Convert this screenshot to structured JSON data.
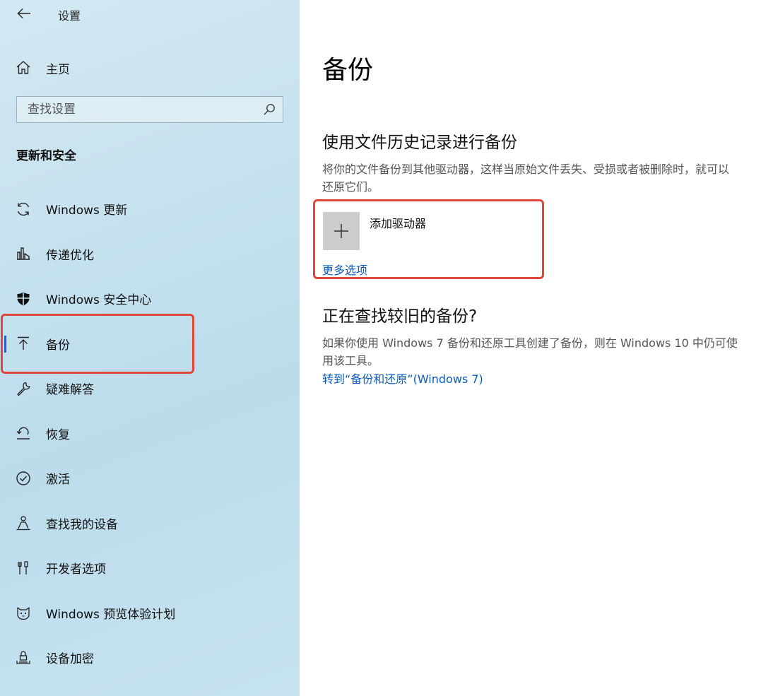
{
  "window": {
    "title": "设置",
    "back_icon": "arrow-left-icon"
  },
  "sidebar": {
    "home_label": "主页",
    "search_placeholder": "查找设置",
    "section_header": "更新和安全",
    "items": [
      {
        "label": "Windows 更新",
        "icon": "sync-icon",
        "selected": false
      },
      {
        "label": "传递优化",
        "icon": "delivery-optimization-icon",
        "selected": false
      },
      {
        "label": "Windows 安全中心",
        "icon": "shield-icon",
        "selected": false
      },
      {
        "label": "备份",
        "icon": "backup-arrow-up-icon",
        "selected": true
      },
      {
        "label": "疑难解答",
        "icon": "wrench-icon",
        "selected": false
      },
      {
        "label": "恢复",
        "icon": "recovery-icon",
        "selected": false
      },
      {
        "label": "激活",
        "icon": "check-circle-icon",
        "selected": false
      },
      {
        "label": "查找我的设备",
        "icon": "person-location-icon",
        "selected": false
      },
      {
        "label": "开发者选项",
        "icon": "developer-tools-icon",
        "selected": false
      },
      {
        "label": "Windows 预览体验计划",
        "icon": "insider-cat-icon",
        "selected": false
      },
      {
        "label": "设备加密",
        "icon": "device-encryption-icon",
        "selected": false
      }
    ]
  },
  "main": {
    "page_title": "备份",
    "file_history": {
      "heading": "使用文件历史记录进行备份",
      "description": "将你的文件备份到其他驱动器，这样当原始文件丢失、受损或者被删除时，就可以还原它们。",
      "add_drive_label": "添加驱动器",
      "more_options_link": "更多选项"
    },
    "older_backup": {
      "heading": "正在查找较旧的备份?",
      "description": "如果你使用 Windows 7 备份和还原工具创建了备份，则在 Windows 10 中仍可使用该工具。",
      "link": "转到“备份和还原”(Windows 7)"
    }
  },
  "colors": {
    "accent": "#2a62c9",
    "link": "#0a5bbd",
    "annotation_red": "#e0473a",
    "sidebar_bg": "#c5e1ee"
  }
}
